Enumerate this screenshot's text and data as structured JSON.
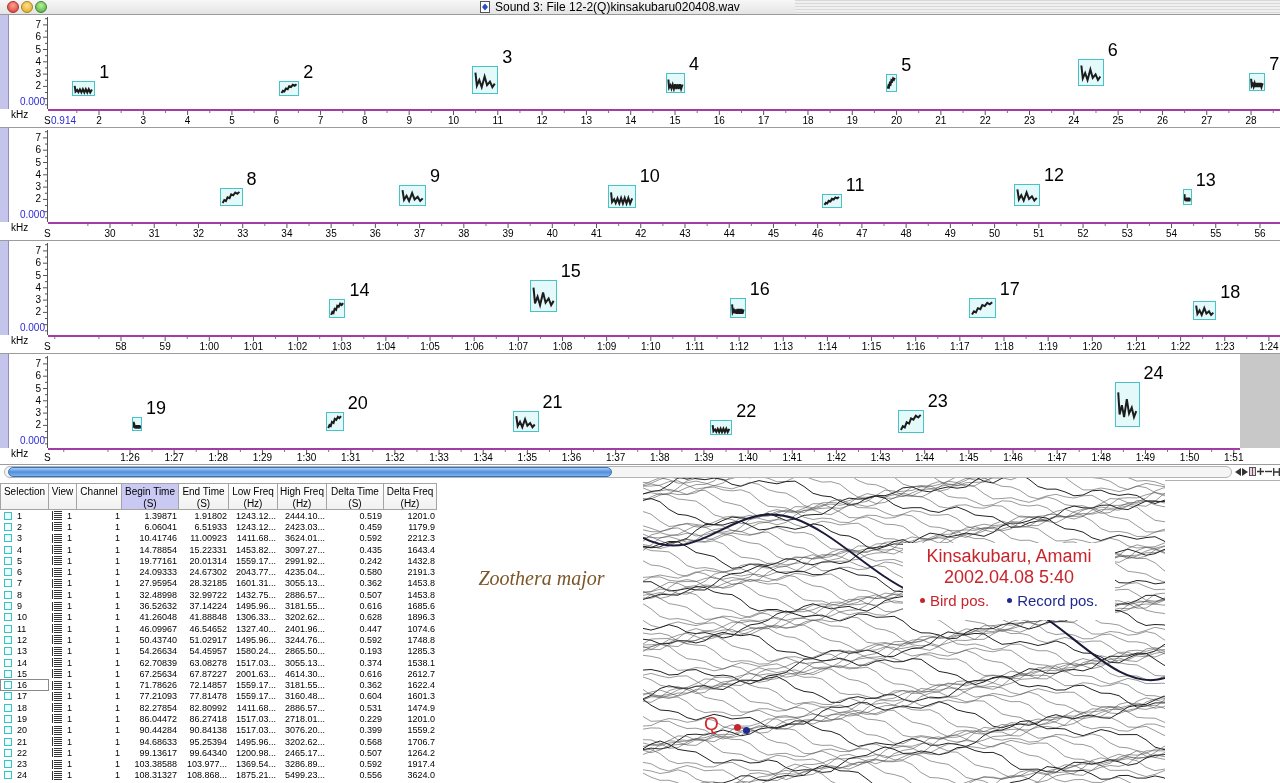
{
  "window": {
    "title": "Sound 3: File 12-2(Q)kinsakubaru020408.wav"
  },
  "spectrogram_panes": [
    {
      "freq_ticks": [
        "7",
        "6",
        "5",
        "4",
        "3",
        "2"
      ],
      "freq_origin": "0.000",
      "freq_unit": "kHz",
      "time_unit": "S",
      "time_start": "0.914",
      "time_ticks": [
        "2",
        "3",
        "4",
        "5",
        "6",
        "7",
        "8",
        "9",
        "10",
        "11",
        "12",
        "13",
        "14",
        "15",
        "16",
        "17",
        "18",
        "19",
        "20",
        "21",
        "22",
        "23",
        "24",
        "25",
        "26",
        "27",
        "28"
      ],
      "selections": [
        {
          "label": "1"
        },
        {
          "label": "2"
        },
        {
          "label": "3"
        },
        {
          "label": "4"
        },
        {
          "label": "5"
        },
        {
          "label": "6"
        },
        {
          "label": "7"
        }
      ]
    },
    {
      "freq_ticks": [
        "7",
        "6",
        "5",
        "4",
        "3",
        "2"
      ],
      "freq_origin": "0.000",
      "freq_unit": "kHz",
      "time_unit": "S",
      "time_ticks": [
        "30",
        "31",
        "32",
        "33",
        "34",
        "35",
        "36",
        "37",
        "38",
        "39",
        "40",
        "41",
        "42",
        "43",
        "44",
        "45",
        "46",
        "47",
        "48",
        "49",
        "50",
        "51",
        "52",
        "53",
        "54",
        "55",
        "56"
      ],
      "selections": [
        {
          "label": "8"
        },
        {
          "label": "9"
        },
        {
          "label": "10"
        },
        {
          "label": "11"
        },
        {
          "label": "12"
        },
        {
          "label": "13"
        }
      ]
    },
    {
      "freq_ticks": [
        "7",
        "6",
        "5",
        "4",
        "3",
        "2"
      ],
      "freq_origin": "0.000",
      "freq_unit": "kHz",
      "time_unit": "S",
      "time_ticks": [
        "58",
        "59",
        "1:00",
        "1:01",
        "1:02",
        "1:03",
        "1:04",
        "1:05",
        "1:06",
        "1:07",
        "1:08",
        "1:09",
        "1:10",
        "1:11",
        "1:12",
        "1:13",
        "1:14",
        "1:15",
        "1:16",
        "1:17",
        "1:18",
        "1:19",
        "1:20",
        "1:21",
        "1:22",
        "1:23",
        "1:24"
      ],
      "selections": [
        {
          "label": "14"
        },
        {
          "label": "15"
        },
        {
          "label": "16"
        },
        {
          "label": "17"
        },
        {
          "label": "18"
        }
      ]
    },
    {
      "freq_ticks": [
        "7",
        "6",
        "5",
        "4",
        "3",
        "2"
      ],
      "freq_origin": "0.000",
      "freq_unit": "kHz",
      "time_unit": "S",
      "time_ticks": [
        "1:26",
        "1:27",
        "1:28",
        "1:29",
        "1:30",
        "1:31",
        "1:32",
        "1:33",
        "1:34",
        "1:35",
        "1:36",
        "1:37",
        "1:38",
        "1:39",
        "1:40",
        "1:41",
        "1:42",
        "1:43",
        "1:44",
        "1:45",
        "1:46",
        "1:47",
        "1:48",
        "1:49",
        "1:50",
        "1:51"
      ],
      "selections": [
        {
          "label": "19"
        },
        {
          "label": "20"
        },
        {
          "label": "21"
        },
        {
          "label": "22"
        },
        {
          "label": "23"
        },
        {
          "label": "24"
        }
      ]
    }
  ],
  "table": {
    "columns": [
      {
        "label": "Selection",
        "selected": false
      },
      {
        "label": "View",
        "selected": false
      },
      {
        "label": "Channel",
        "selected": false
      },
      {
        "label": "Begin Time",
        "unit": "(S)",
        "selected": true
      },
      {
        "label": "End Time",
        "unit": "(S)",
        "selected": false
      },
      {
        "label": "Low Freq",
        "unit": "(Hz)",
        "selected": false
      },
      {
        "label": "High Freq",
        "unit": "(Hz)",
        "selected": false
      },
      {
        "label": "Delta Time",
        "unit": "(S)",
        "selected": false
      },
      {
        "label": "Delta Freq",
        "unit": "(Hz)",
        "selected": false
      }
    ],
    "rows": [
      {
        "selected": false,
        "cells": [
          "1",
          "1",
          "1",
          "1.39871",
          "1.91802",
          "1243.12...",
          "2444.10...",
          "0.519",
          "1201.0"
        ]
      },
      {
        "selected": false,
        "cells": [
          "2",
          "1",
          "1",
          "6.06041",
          "6.51933",
          "1243.12...",
          "2423.03...",
          "0.459",
          "1179.9"
        ]
      },
      {
        "selected": false,
        "cells": [
          "3",
          "1",
          "1",
          "10.41746",
          "11.00923",
          "1411.68...",
          "3624.01...",
          "0.592",
          "2212.3"
        ]
      },
      {
        "selected": false,
        "cells": [
          "4",
          "1",
          "1",
          "14.78854",
          "15.22331",
          "1453.82...",
          "3097.27...",
          "0.435",
          "1643.4"
        ]
      },
      {
        "selected": false,
        "cells": [
          "5",
          "1",
          "1",
          "19.77161",
          "20.01314",
          "1559.17...",
          "2991.92...",
          "0.242",
          "1432.8"
        ]
      },
      {
        "selected": false,
        "cells": [
          "6",
          "1",
          "1",
          "24.09333",
          "24.67302",
          "2043.77...",
          "4235.04...",
          "0.580",
          "2191.3"
        ]
      },
      {
        "selected": false,
        "cells": [
          "7",
          "1",
          "1",
          "27.95954",
          "28.32185",
          "1601.31...",
          "3055.13...",
          "0.362",
          "1453.8"
        ]
      },
      {
        "selected": false,
        "cells": [
          "8",
          "1",
          "1",
          "32.48998",
          "32.99722",
          "1432.75...",
          "2886.57...",
          "0.507",
          "1453.8"
        ]
      },
      {
        "selected": false,
        "cells": [
          "9",
          "1",
          "1",
          "36.52632",
          "37.14224",
          "1495.96...",
          "3181.55...",
          "0.616",
          "1685.6"
        ]
      },
      {
        "selected": false,
        "cells": [
          "10",
          "1",
          "1",
          "41.26048",
          "41.88848",
          "1306.33...",
          "3202.62...",
          "0.628",
          "1896.3"
        ]
      },
      {
        "selected": false,
        "cells": [
          "11",
          "1",
          "1",
          "46.09967",
          "46.54652",
          "1327.40...",
          "2401.96...",
          "0.447",
          "1074.6"
        ]
      },
      {
        "selected": false,
        "cells": [
          "12",
          "1",
          "1",
          "50.43740",
          "51.02917",
          "1495.96...",
          "3244.76...",
          "0.592",
          "1748.8"
        ]
      },
      {
        "selected": false,
        "cells": [
          "13",
          "1",
          "1",
          "54.26634",
          "54.45957",
          "1580.24...",
          "2865.50...",
          "0.193",
          "1285.3"
        ]
      },
      {
        "selected": false,
        "cells": [
          "14",
          "1",
          "1",
          "62.70839",
          "63.08278",
          "1517.03...",
          "3055.13...",
          "0.374",
          "1538.1"
        ]
      },
      {
        "selected": false,
        "cells": [
          "15",
          "1",
          "1",
          "67.25634",
          "67.87227",
          "2001.63...",
          "4614.30...",
          "0.616",
          "2612.7"
        ]
      },
      {
        "selected": true,
        "cells": [
          "16",
          "1",
          "1",
          "71.78626",
          "72.14857",
          "1559.17...",
          "3181.55...",
          "0.362",
          "1622.4"
        ]
      },
      {
        "selected": false,
        "cells": [
          "17",
          "1",
          "1",
          "77.21093",
          "77.81478",
          "1559.17...",
          "3160.48...",
          "0.604",
          "1601.3"
        ]
      },
      {
        "selected": false,
        "cells": [
          "18",
          "1",
          "1",
          "82.27854",
          "82.80992",
          "1411.68...",
          "2886.57...",
          "0.531",
          "1474.9"
        ]
      },
      {
        "selected": false,
        "cells": [
          "19",
          "1",
          "1",
          "86.04472",
          "86.27418",
          "1517.03...",
          "2718.01...",
          "0.229",
          "1201.0"
        ]
      },
      {
        "selected": false,
        "cells": [
          "20",
          "1",
          "1",
          "90.44284",
          "90.84138",
          "1517.03...",
          "3076.20...",
          "0.399",
          "1559.2"
        ]
      },
      {
        "selected": false,
        "cells": [
          "21",
          "1",
          "1",
          "94.68633",
          "95.25394",
          "1495.96...",
          "3202.62...",
          "0.568",
          "1706.7"
        ]
      },
      {
        "selected": false,
        "cells": [
          "22",
          "1",
          "1",
          "99.13617",
          "99.64340",
          "1200.98...",
          "2465.17...",
          "0.507",
          "1264.2"
        ]
      },
      {
        "selected": false,
        "cells": [
          "23",
          "1",
          "1",
          "103.38588",
          "103.977...",
          "1369.54...",
          "3286.89...",
          "0.592",
          "1917.4"
        ]
      },
      {
        "selected": false,
        "cells": [
          "24",
          "1",
          "1",
          "108.31327",
          "108.868...",
          "1875.21...",
          "5499.23...",
          "0.556",
          "3624.0"
        ]
      }
    ]
  },
  "species": "Zoothera major",
  "map": {
    "legend": {
      "title": "Kinsakubaru, Amami",
      "subtitle": "2002.04.08 5:40",
      "items": [
        {
          "label": "Bird pos.",
          "color": "#c8242b"
        },
        {
          "label": "Record pos.",
          "color": "#1f2a8c"
        }
      ]
    },
    "site_label": "Q"
  }
}
